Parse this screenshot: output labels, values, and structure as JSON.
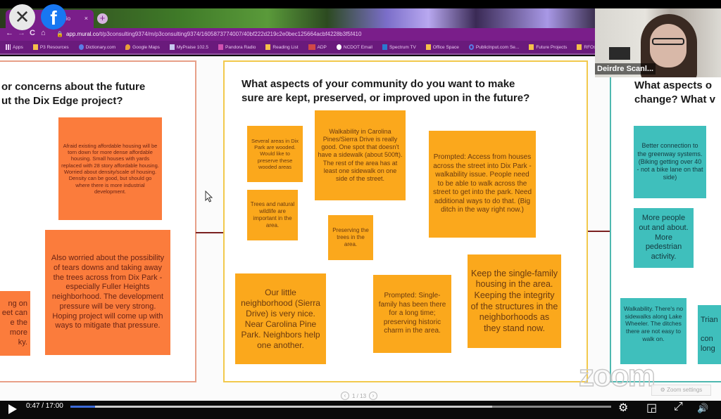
{
  "overlay": {
    "close_glyph": "✕",
    "facebook_glyph": "f"
  },
  "browser": {
    "tab_title": "- Visio",
    "tab_close": "×",
    "new_tab": "+",
    "nav": {
      "back": "←",
      "forward": "→",
      "reload": "C",
      "home": "⌂"
    },
    "url_host": "app.mural.co",
    "url_path": "/t/p3consulting9374/m/p3consulting9374/1605873774007/40bf222d219c2e0bec125664acbf4228b3f5f410",
    "bookmarks": [
      "Apps",
      "P3 Resources",
      "Dictionary.com",
      "Google Maps",
      "MyPraise 102.5",
      "Pandora Radio",
      "Reading List",
      "ADP",
      "NCDOT Email",
      "Spectrum TV",
      "Office Space",
      "PublicInput.com Se...",
      "Future Projects",
      "RFOs"
    ]
  },
  "mural": {
    "left_frame": {
      "title_line1": "or concerns about the future",
      "title_line2": "ut the Dix Edge project?",
      "stickies": [
        "Afraid existing affordable housing will be torn down for more dense affordable housing. Small houses with yards replaced with 28 story affordable housing. Worried about density/scale of housing. Density can be good, but should go where there is more industrial development.",
        "Also worried about the possibility of tears downs and taking away the trees across from Dix Park - especially Fuller Heights neighborhood. The development pressure will be very strong. Hoping project will come up with ways to mitigate that pressure.",
        "ng on\neet can\ne the\n more\nky."
      ]
    },
    "mid_frame": {
      "title": "What aspects of your community do you want to make sure are kept, preserved, or improved upon in the future?",
      "stickies": [
        "Several areas in Dix Park are wooded. Would like to preserve these wooded areas",
        "Walkability in Carolina Pines/Sierra Drive is really good. One spot that doesn't have a sidewalk (about 500ft). The rest of the area has at least one sidewalk on one side of the street.",
        "Prompted: Access from houses across the street into Dix Park - walkability issue. People need to be able to walk across the street to get into the park. Need additional ways to do that. (Big ditch in the way right now.)",
        "Trees and natural wildlife are important in the area.",
        "Preserving the trees in the area.",
        "Our little neighborhood (Sierra Drive) is very nice. Near Carolina Pine Park. Neighbors help one another.",
        "Prompted: Single-family has been there for a long time; preserving historic charm in the area.",
        "Keep the single-family housing in the area. Keeping the integrity of the structures in the neighborhoods as they stand now."
      ]
    },
    "right_frame": {
      "title_line1": "What aspects o",
      "title_line2": "change? What v",
      "stickies": [
        "Better connection to the greenway systems. (Biking getting over 40 - not a bike lane on that side)",
        "More people out and about. More pedestrian activity.",
        "Walkability. There's no sidewalks along Lake Wheeler. The ditches there are not easy to walk on.",
        "Trian\n\ncon\nlong"
      ]
    },
    "page_indicator": "1 / 13",
    "prev_glyph": "‹",
    "next_glyph": "›"
  },
  "zoom": {
    "watermark": "zoom",
    "settings_label": "⚙ Zoom settings",
    "participant_name": "Deirdre Scanl..."
  },
  "player": {
    "time_display": "0:47 / 17:00",
    "progress_fraction": 0.046,
    "buffered_fraction": 0.78,
    "icons": {
      "settings": "⚙",
      "pip": "◲",
      "fullscreen": "⤢",
      "volume": "🔊"
    }
  }
}
